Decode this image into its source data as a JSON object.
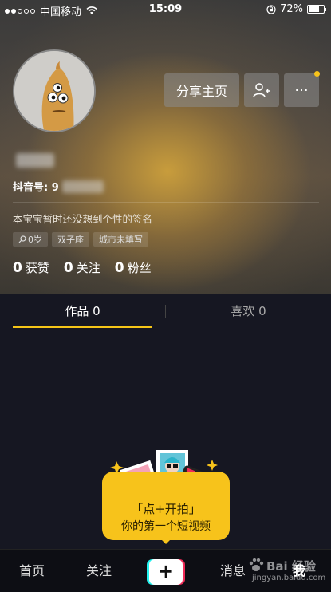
{
  "status_bar": {
    "carrier": "中国移动",
    "time": "15:09",
    "battery": "72%",
    "battery_level": 0.72
  },
  "profile": {
    "share_button": "分享主页",
    "more_button": "···",
    "id_label": "抖音号: 9",
    "signature": "本宝宝暂时还没想到个性的签名",
    "tags": [
      {
        "label": "0岁",
        "icon": "gender-icon"
      },
      {
        "label": "双子座"
      },
      {
        "label": "城市未填写"
      }
    ],
    "stats": [
      {
        "count": "0",
        "label": "获赞"
      },
      {
        "count": "0",
        "label": "关注"
      },
      {
        "count": "0",
        "label": "粉丝"
      }
    ]
  },
  "tabs": {
    "works": "作品 0",
    "likes": "喜欢 0"
  },
  "promo": {
    "line1": "「点+开拍」",
    "line2": "你的第一个短视频"
  },
  "bottom_nav": {
    "home": "首页",
    "follow": "关注",
    "plus": "+",
    "messages": "消息",
    "me": "我"
  },
  "watermark": {
    "logo": "Bai 经验",
    "url": "jingyan.baidu.com"
  },
  "colors": {
    "accent": "#f7c31b",
    "background": "#161722",
    "plus_cyan": "#23f2ee",
    "plus_red": "#ef2a57"
  }
}
